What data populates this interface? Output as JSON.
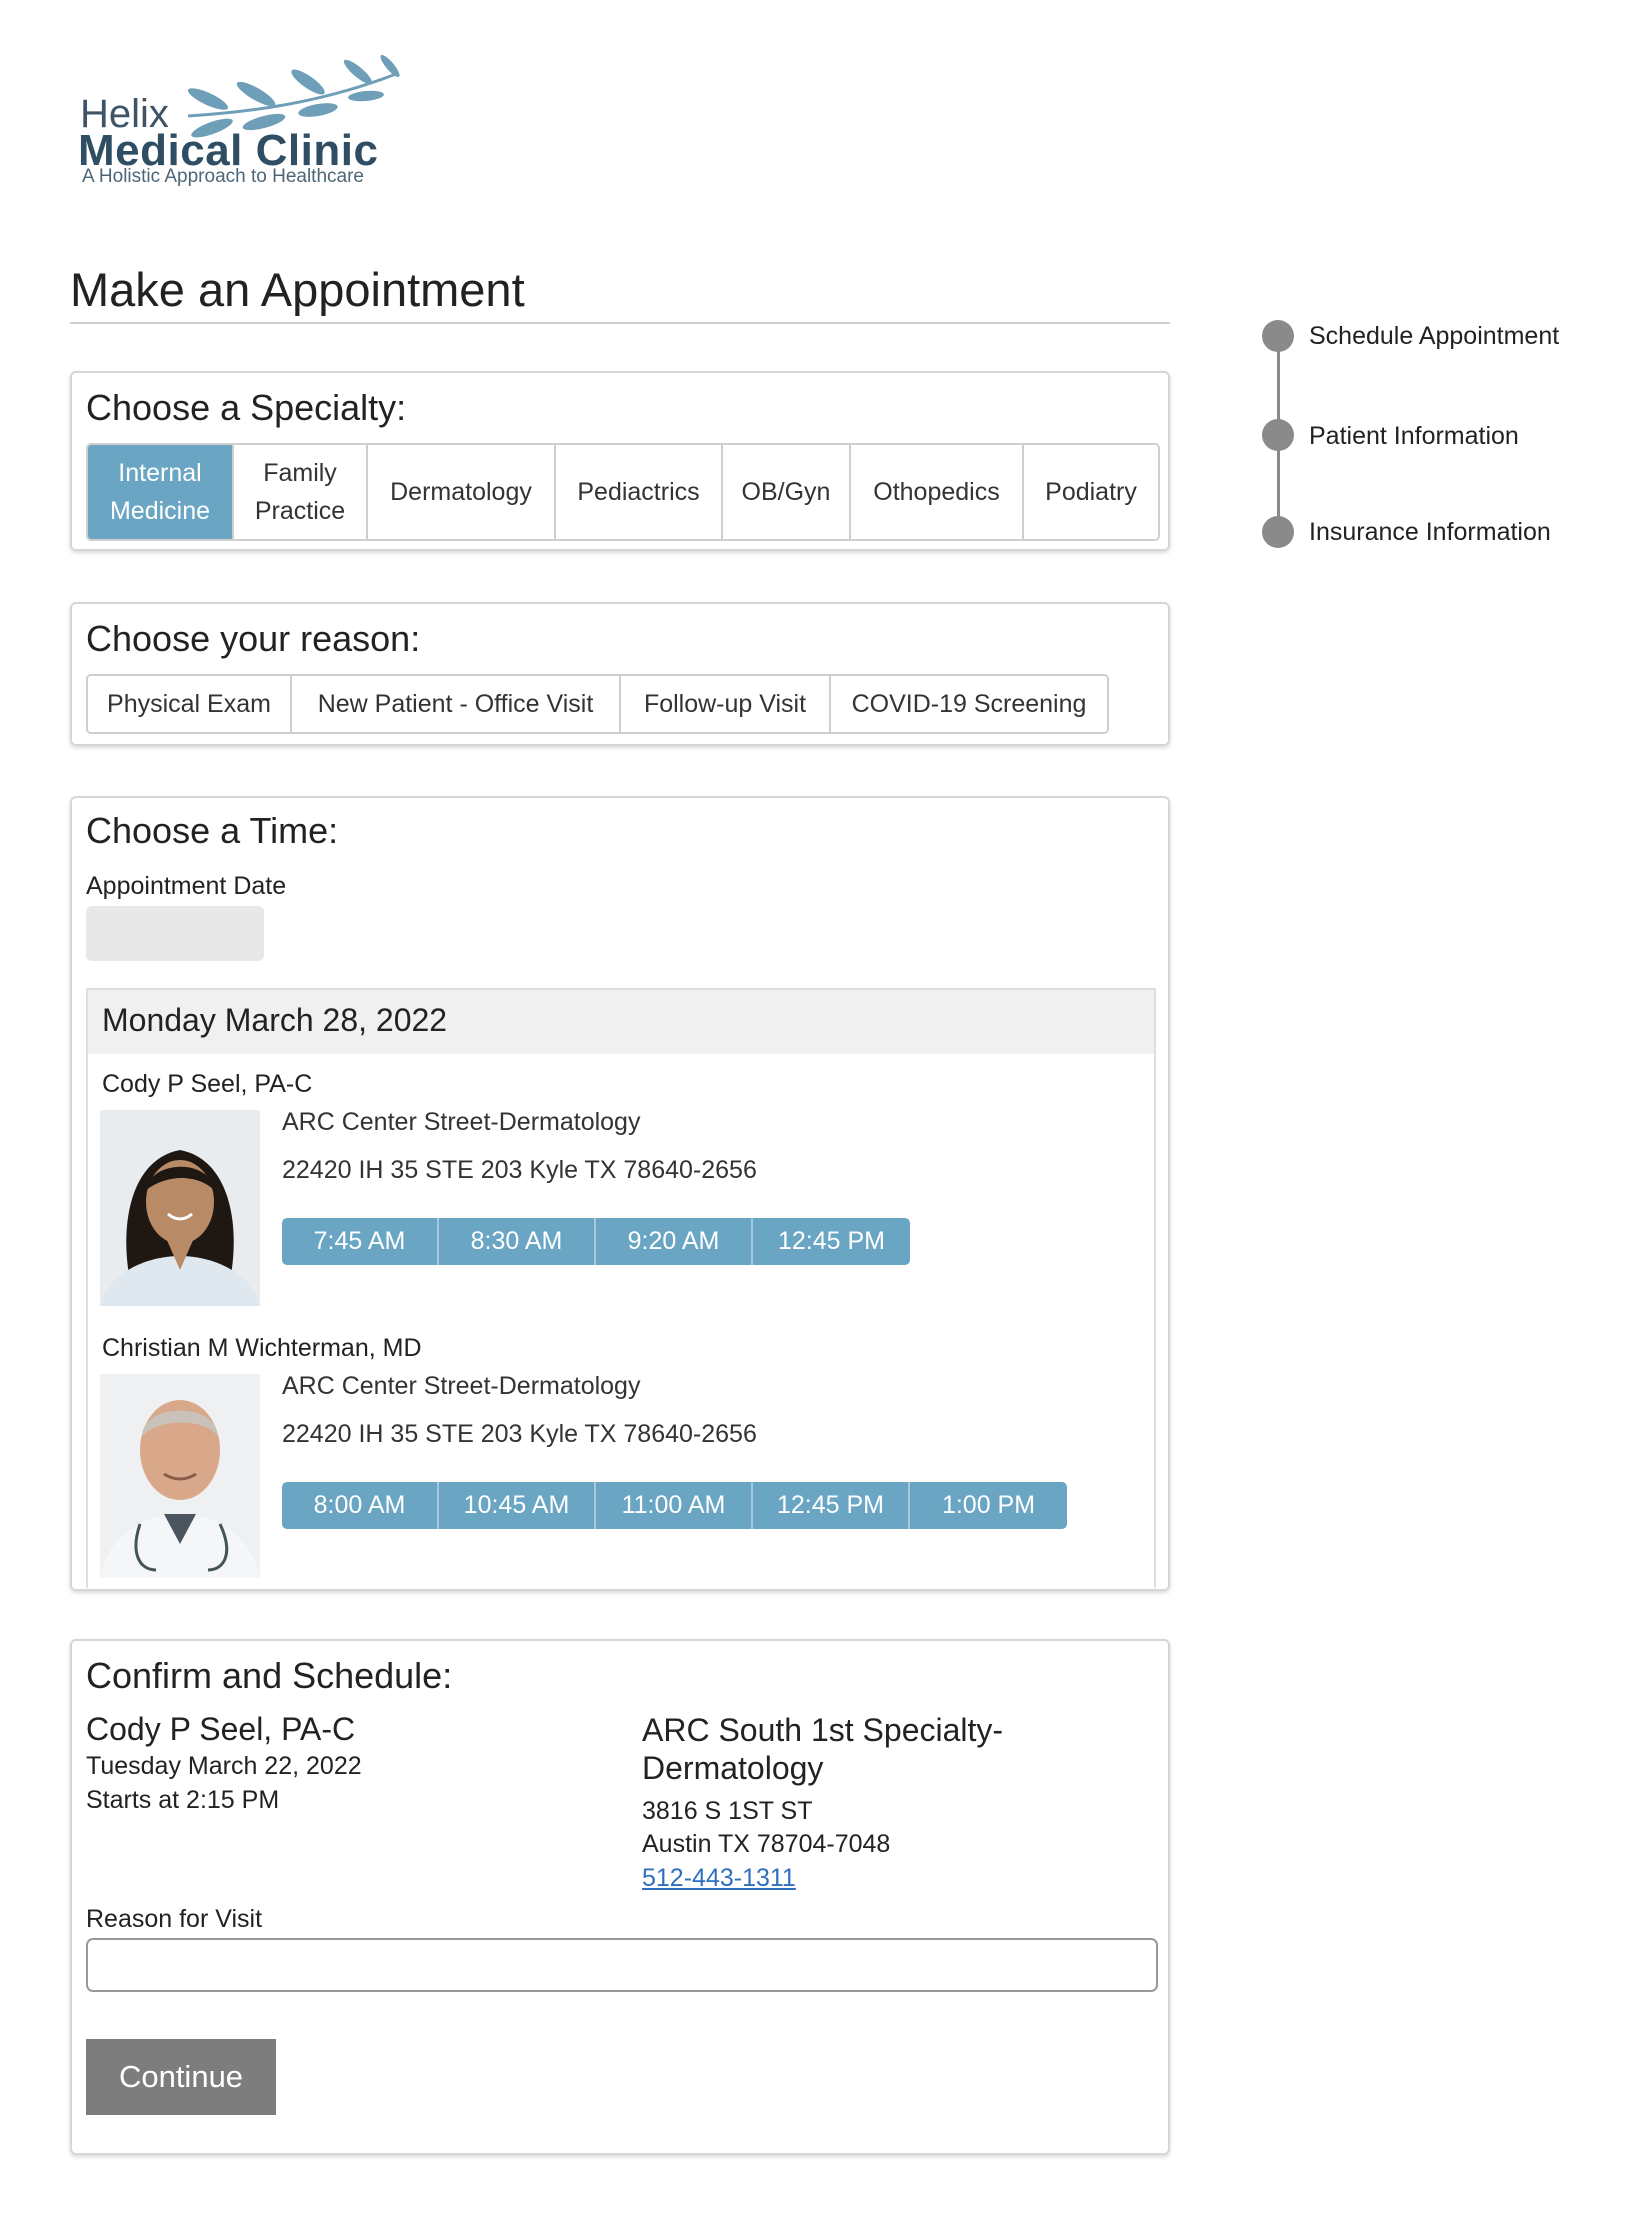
{
  "brand": {
    "word1": "Helix",
    "word2": "Medical Clinic",
    "tagline": "A Holistic Approach to Healthcare",
    "accent_color": "#6aa6c4"
  },
  "page_title": "Make an Appointment",
  "specialty": {
    "heading": "Choose a Specialty:",
    "options": [
      "Internal Medicine",
      "Family Practice",
      "Dermatology",
      "Pediactrics",
      "OB/Gyn",
      "Othopedics",
      "Podiatry"
    ],
    "selected": "Internal Medicine"
  },
  "reason": {
    "heading": "Choose your reason:",
    "options": [
      "Physical Exam",
      "New Patient - Office Visit",
      "Follow-up Visit",
      "COVID-19 Screening"
    ]
  },
  "time": {
    "heading": "Choose a Time:",
    "date_label": "Appointment Date",
    "date_value": "",
    "day": "Monday March 28, 2022",
    "providers": [
      {
        "name": "Cody P Seel, PA-C",
        "photo_icon": "female-provider-photo",
        "location": "ARC Center Street-Dermatology",
        "address": "22420 IH 35 STE 203 Kyle TX 78640-2656",
        "slots": [
          "7:45 AM",
          "8:30 AM",
          "9:20 AM",
          "12:45 PM"
        ]
      },
      {
        "name": "Christian M Wichterman, MD",
        "photo_icon": "male-provider-photo",
        "location": "ARC Center Street-Dermatology",
        "address": "22420 IH 35 STE 203 Kyle TX 78640-2656",
        "slots": [
          "8:00 AM",
          "10:45 AM",
          "11:00 AM",
          "12:45 PM",
          "1:00 PM"
        ]
      }
    ]
  },
  "confirm": {
    "heading": "Confirm and Schedule:",
    "provider": "Cody P Seel, PA-C",
    "date": "Tuesday March 22, 2022",
    "start": "Starts at 2:15 PM",
    "location": "ARC South 1st Specialty-Dermatology",
    "street": "3816 S 1ST ST",
    "city": "Austin TX 78704-7048",
    "phone": "512-443-1311",
    "reason_label": "Reason for Visit",
    "reason_value": "",
    "continue_label": "Continue"
  },
  "steps": [
    "Schedule Appointment",
    "Patient Information",
    "Insurance Information"
  ]
}
